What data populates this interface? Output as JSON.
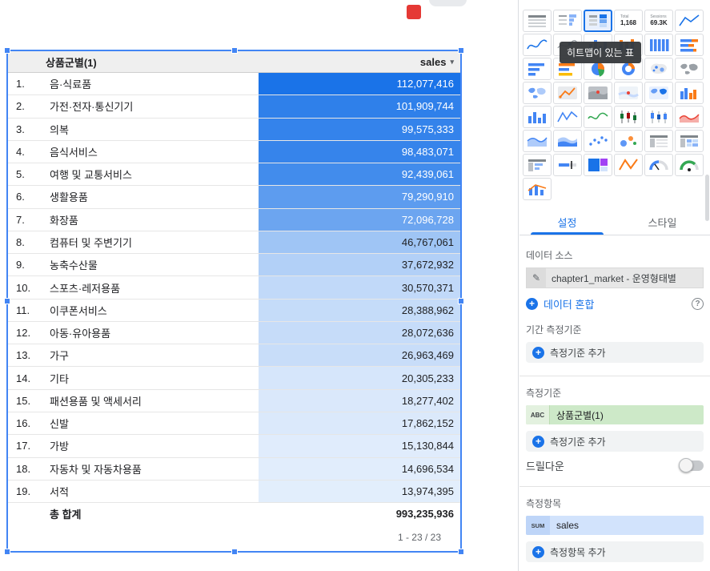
{
  "canvas": {
    "table": {
      "dimension_header": "상품군별(1)",
      "metric_header": "sales",
      "rows": [
        {
          "n": "1.",
          "name": "음·식료품",
          "value": "112,077,416",
          "raw": 112077416
        },
        {
          "n": "2.",
          "name": "가전·전자·통신기기",
          "value": "101,909,744",
          "raw": 101909744
        },
        {
          "n": "3.",
          "name": "의복",
          "value": "99,575,333",
          "raw": 99575333
        },
        {
          "n": "4.",
          "name": "음식서비스",
          "value": "98,483,071",
          "raw": 98483071
        },
        {
          "n": "5.",
          "name": "여행 및 교통서비스",
          "value": "92,439,061",
          "raw": 92439061
        },
        {
          "n": "6.",
          "name": "생활용품",
          "value": "79,290,910",
          "raw": 79290910
        },
        {
          "n": "7.",
          "name": "화장품",
          "value": "72,096,728",
          "raw": 72096728
        },
        {
          "n": "8.",
          "name": "컴퓨터 및 주변기기",
          "value": "46,767,061",
          "raw": 46767061
        },
        {
          "n": "9.",
          "name": "농축수산물",
          "value": "37,672,932",
          "raw": 37672932
        },
        {
          "n": "10.",
          "name": "스포츠·레저용품",
          "value": "30,570,371",
          "raw": 30570371
        },
        {
          "n": "11.",
          "name": "이쿠폰서비스",
          "value": "28,388,962",
          "raw": 28388962
        },
        {
          "n": "12.",
          "name": "아동·유아용품",
          "value": "28,072,636",
          "raw": 28072636
        },
        {
          "n": "13.",
          "name": "가구",
          "value": "26,963,469",
          "raw": 26963469
        },
        {
          "n": "14.",
          "name": "기타",
          "value": "20,305,233",
          "raw": 20305233
        },
        {
          "n": "15.",
          "name": "패션용품 및 액세서리",
          "value": "18,277,402",
          "raw": 18277402
        },
        {
          "n": "16.",
          "name": "신발",
          "value": "17,862,152",
          "raw": 17862152
        },
        {
          "n": "17.",
          "name": "가방",
          "value": "15,130,844",
          "raw": 15130844
        },
        {
          "n": "18.",
          "name": "자동차 및 자동차용품",
          "value": "14,696,534",
          "raw": 14696534
        },
        {
          "n": "19.",
          "name": "서적",
          "value": "13,974,395",
          "raw": 13974395
        }
      ],
      "total_label": "총 합계",
      "total_value": "993,235,936",
      "pagination": "1 - 23 / 23"
    }
  },
  "chart_data": {
    "type": "table",
    "title": "히트맵이 있는 표",
    "dimension": "상품군별(1)",
    "metric": "sales",
    "categories": [
      "음·식료품",
      "가전·전자·통신기기",
      "의복",
      "음식서비스",
      "여행 및 교통서비스",
      "생활용품",
      "화장품",
      "컴퓨터 및 주변기기",
      "농축수산물",
      "스포츠·레저용품",
      "이쿠폰서비스",
      "아동·유아용품",
      "가구",
      "기타",
      "패션용품 및 액세서리",
      "신발",
      "가방",
      "자동차 및 자동차용품",
      "서적"
    ],
    "values": [
      112077416,
      101909744,
      99575333,
      98483071,
      92439061,
      79290910,
      72096728,
      46767061,
      37672932,
      30570371,
      28388962,
      28072636,
      26963469,
      20305233,
      18277402,
      17862152,
      15130844,
      14696534,
      13974395
    ],
    "total": 993235936,
    "heatmap": {
      "min_color": "#ffffff",
      "max_color": "#1a73e8"
    }
  },
  "picker": {
    "tooltip": "히트맵이 있는 표",
    "icons": [
      {
        "name": "table",
        "glyph": "table"
      },
      {
        "name": "table-with-bars",
        "glyph": "tableBars"
      },
      {
        "name": "table-with-heatmap",
        "glyph": "tableHeat",
        "selected": true
      },
      {
        "name": "scorecard",
        "glyph": "score",
        "label": "Total",
        "value": "1,168"
      },
      {
        "name": "scorecard-compact",
        "glyph": "score",
        "label": "Sessions",
        "value": "69.3K"
      },
      {
        "name": "time-series",
        "glyph": "line"
      },
      {
        "name": "smoothed-time-series",
        "glyph": "smooth"
      },
      {
        "name": "time-series-points",
        "glyph": "smooth2"
      },
      {
        "name": "column-chart",
        "glyph": "column"
      },
      {
        "name": "stacked-column-chart",
        "glyph": "columnStacked"
      },
      {
        "name": "100-stacked-column-chart",
        "glyph": "column100"
      },
      {
        "name": "stacked-bar-chart",
        "glyph": "barStackH"
      },
      {
        "name": "bar-chart",
        "glyph": "barH"
      },
      {
        "name": "100-stacked-bar-chart",
        "glyph": "barH2"
      },
      {
        "name": "pie-chart",
        "glyph": "pie"
      },
      {
        "name": "donut-chart",
        "glyph": "donut"
      },
      {
        "name": "geo-bubble-map",
        "glyph": "geoDots"
      },
      {
        "name": "geo-chart",
        "glyph": "world"
      },
      {
        "name": "filled-geo-map",
        "glyph": "worldBlue"
      },
      {
        "name": "route-map",
        "glyph": "mapRoute"
      },
      {
        "name": "heat-map",
        "glyph": "mapDark"
      },
      {
        "name": "google-map",
        "glyph": "mapLight"
      },
      {
        "name": "choropleth-map",
        "glyph": "worldFill"
      },
      {
        "name": "grouped-column-chart",
        "glyph": "hist"
      },
      {
        "name": "column-chart-single",
        "glyph": "column"
      },
      {
        "name": "line-chart",
        "glyph": "zigzag"
      },
      {
        "name": "smooth-line-chart",
        "glyph": "wave"
      },
      {
        "name": "candlestick-chart",
        "glyph": "candle"
      },
      {
        "name": "candlestick-chart-2",
        "glyph": "candle2"
      },
      {
        "name": "area-chart-red",
        "glyph": "areaRed"
      },
      {
        "name": "area-chart",
        "glyph": "areaBlue"
      },
      {
        "name": "stacked-area-chart",
        "glyph": "area2"
      },
      {
        "name": "scatter-chart",
        "glyph": "scatter"
      },
      {
        "name": "bubble-chart",
        "glyph": "bubble"
      },
      {
        "name": "pivot-table",
        "glyph": "pivot"
      },
      {
        "name": "pivot-table-heatmap",
        "glyph": "pivot2"
      },
      {
        "name": "pivot-table-bars",
        "glyph": "pivotBars"
      },
      {
        "name": "bullet-chart",
        "glyph": "bullet"
      },
      {
        "name": "treemap-chart",
        "glyph": "treemap"
      },
      {
        "name": "sparkline-chart",
        "glyph": "slope"
      },
      {
        "name": "gauge-chart",
        "glyph": "gauge"
      },
      {
        "name": "gauge-chart-2",
        "glyph": "gauge2"
      },
      {
        "name": "combo-chart",
        "glyph": "combo"
      }
    ]
  },
  "panel": {
    "tabs": {
      "settings": "설정",
      "style": "스타일"
    },
    "data_source": {
      "label": "데이터 소스",
      "value": "chapter1_market - 운영형태별"
    },
    "blend_label": "데이터 혼합",
    "date_dimension": {
      "label": "기간 측정기준",
      "add": "측정기준 추가"
    },
    "dimension": {
      "label": "측정기준",
      "chip_badge": "ABC",
      "chip_value": "상품군별(1)",
      "add": "측정기준 추가"
    },
    "drilldown_label": "드릴다운",
    "metric": {
      "label": "측정항목",
      "chip_badge": "SUM",
      "chip_value": "sales",
      "add": "측정항목 추가"
    }
  },
  "colors": {
    "accent": "#1a73e8",
    "selection": "#4285f4",
    "heat_max": "#1a73e8",
    "chip_dimension": "#cde9c8",
    "chip_metric": "#d2e3fc",
    "swatch_red": "#e53935"
  }
}
